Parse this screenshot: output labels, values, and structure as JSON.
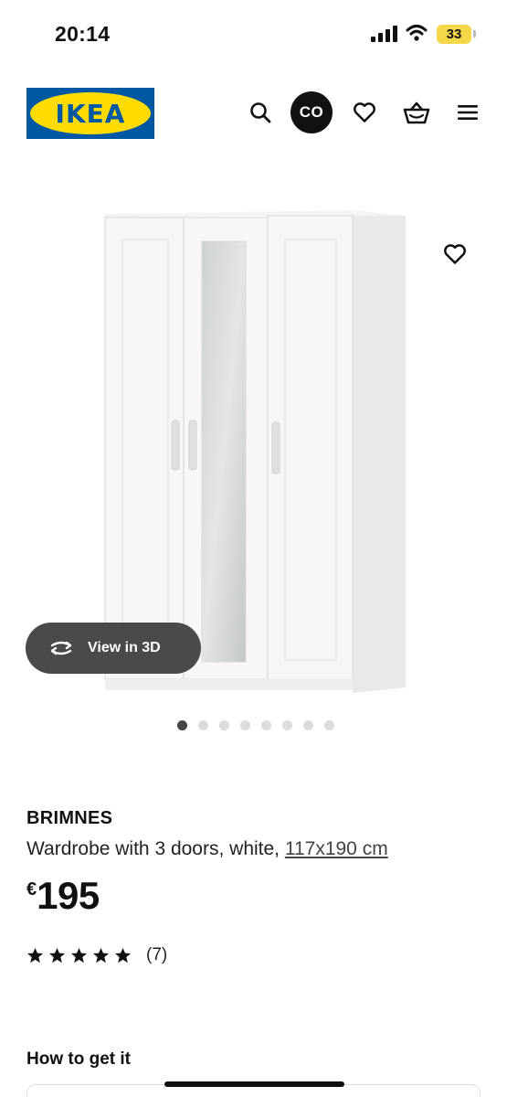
{
  "status_bar": {
    "time": "20:14",
    "battery": "33",
    "icons": [
      "signal-icon",
      "wifi-icon",
      "battery-icon"
    ]
  },
  "header": {
    "logo_text": "IKEA",
    "account_initials": "CO",
    "icons": [
      "search-icon",
      "heart-icon",
      "shopping-bag-icon",
      "menu-icon"
    ],
    "colors": {
      "logo_blue": "#0058a3",
      "logo_yellow": "#ffdb00"
    }
  },
  "gallery": {
    "view_3d_label": "View in 3D",
    "dot_count": 8,
    "active_dot": 0
  },
  "product": {
    "name": "BRIMNES",
    "description": "Wardrobe with 3 doors, white, ",
    "measurement": "117x190 cm",
    "currency": "€",
    "price": "195",
    "rating": 5,
    "rating_max": 5,
    "review_count": "(7)"
  },
  "how_to_get_it": {
    "heading": "How to get it"
  }
}
